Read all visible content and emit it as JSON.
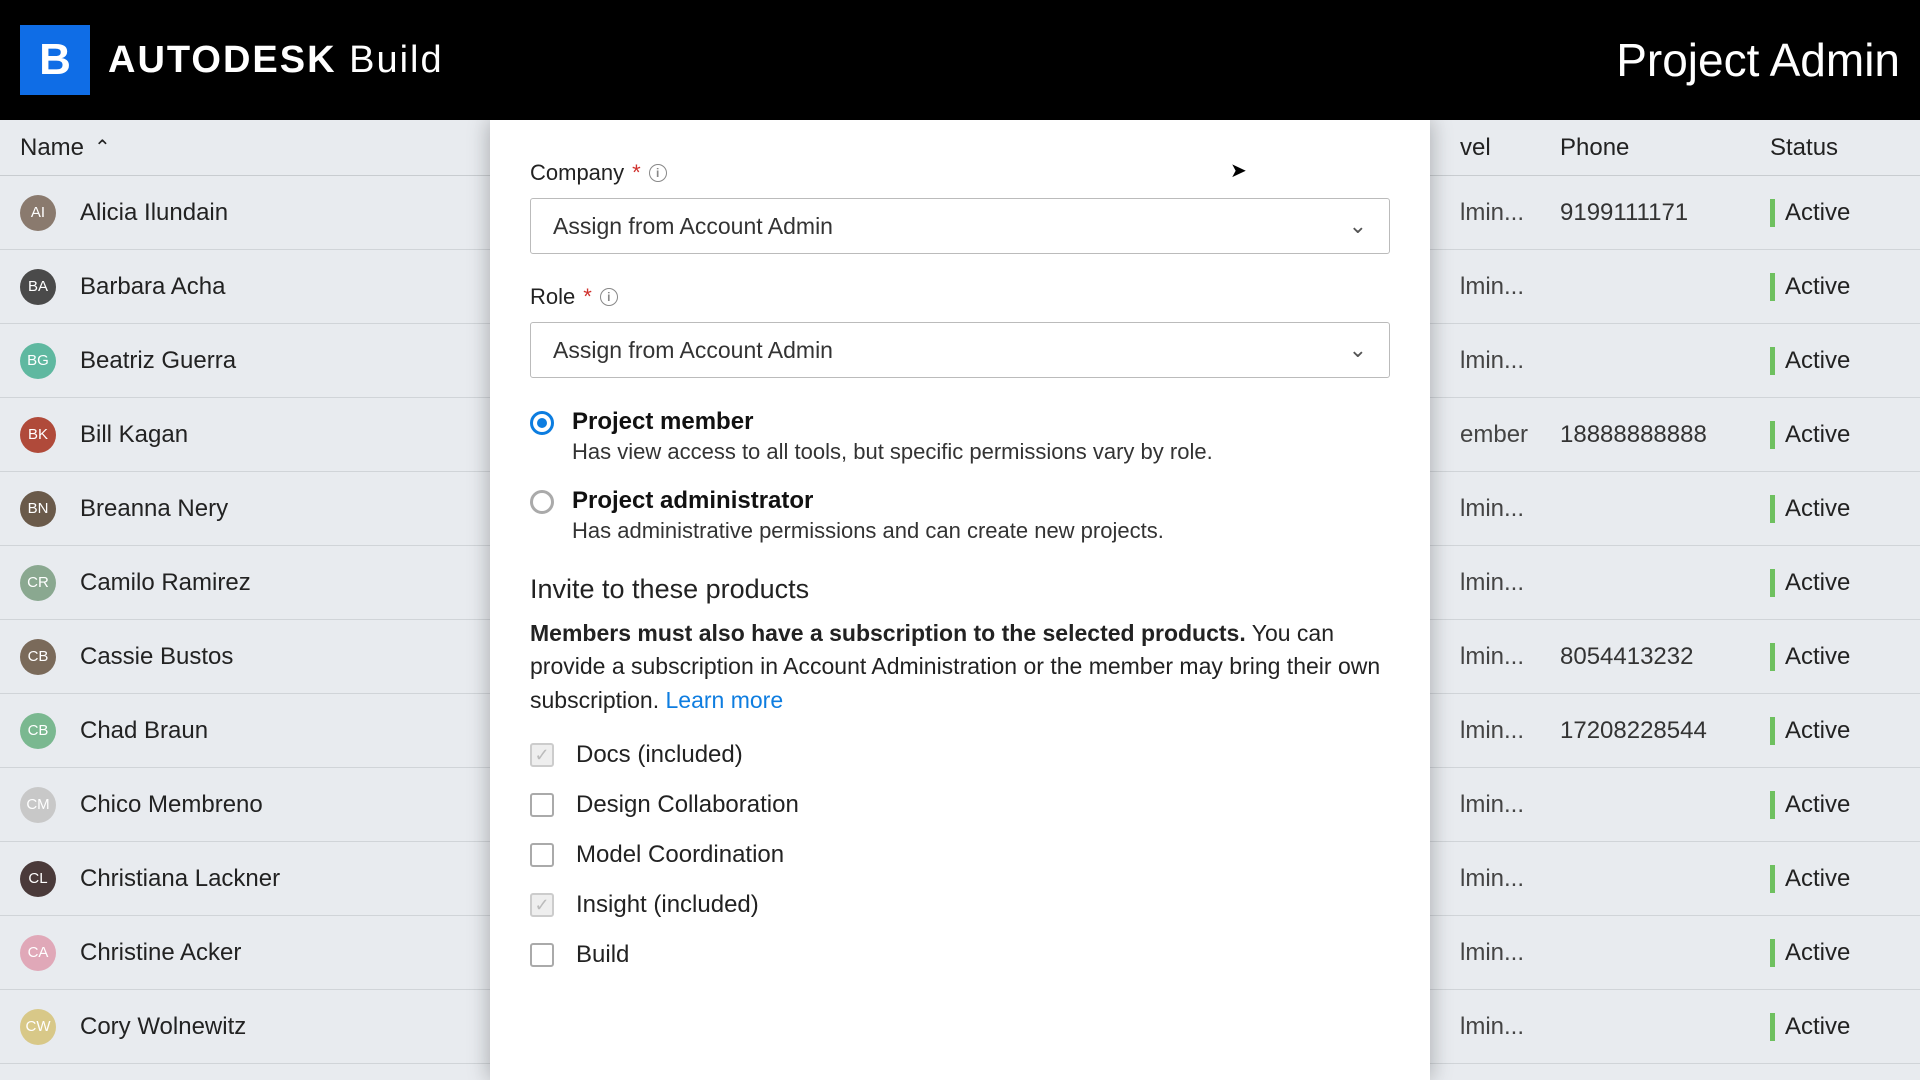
{
  "header": {
    "brand_bold": "AUTODESK",
    "brand_light": "Build",
    "logo_letter": "B",
    "admin": "Project Admin"
  },
  "table": {
    "cols": {
      "name": "Name",
      "level": "vel",
      "phone": "Phone",
      "status": "Status"
    },
    "rows": [
      {
        "name": "Alicia Ilundain",
        "av": "AI",
        "avbg": "#8a7a6e",
        "level": "lmin...",
        "phone": "9199111171",
        "status": "Active"
      },
      {
        "name": "Barbara Acha",
        "av": "BA",
        "avbg": "#4a4a4a",
        "level": "lmin...",
        "phone": "",
        "status": "Active"
      },
      {
        "name": "Beatriz Guerra",
        "av": "BG",
        "avbg": "#5fb8a0",
        "level": "lmin...",
        "phone": "",
        "status": "Active"
      },
      {
        "name": "Bill Kagan",
        "av": "BK",
        "avbg": "#b04a3a",
        "level": "ember",
        "phone": "18888888888",
        "status": "Active"
      },
      {
        "name": "Breanna Nery",
        "av": "BN",
        "avbg": "#6a5a4a",
        "level": "lmin...",
        "phone": "",
        "status": "Active"
      },
      {
        "name": "Camilo Ramirez",
        "av": "CR",
        "avbg": "#8aa890",
        "level": "lmin...",
        "phone": "",
        "status": "Active"
      },
      {
        "name": "Cassie Bustos",
        "av": "CB",
        "avbg": "#7a6a5a",
        "level": "lmin...",
        "phone": "8054413232",
        "status": "Active"
      },
      {
        "name": "Chad Braun",
        "av": "CB",
        "avbg": "#7ab890",
        "level": "lmin...",
        "phone": "17208228544",
        "status": "Active"
      },
      {
        "name": "Chico Membreno",
        "av": "CM",
        "avbg": "#c8c8c8",
        "level": "lmin...",
        "phone": "",
        "status": "Active"
      },
      {
        "name": "Christiana Lackner",
        "av": "CL",
        "avbg": "#4a3a3a",
        "level": "lmin...",
        "phone": "",
        "status": "Active"
      },
      {
        "name": "Christine Acker",
        "av": "CA",
        "avbg": "#e0a8b8",
        "level": "lmin...",
        "phone": "",
        "status": "Active"
      },
      {
        "name": "Cory Wolnewitz",
        "av": "CW",
        "avbg": "#d8c888",
        "level": "lmin...",
        "phone": "",
        "status": "Active"
      }
    ]
  },
  "modal": {
    "company_label": "Company",
    "role_label": "Role",
    "select_placeholder": "Assign from Account Admin",
    "radios": {
      "member": {
        "title": "Project member",
        "desc": "Has view access to all tools, but specific permissions vary by role."
      },
      "admin": {
        "title": "Project administrator",
        "desc": "Has administrative permissions and can create new projects."
      }
    },
    "products": {
      "title": "Invite to these products",
      "desc_bold": "Members must also have a subscription to the selected products.",
      "desc_rest": " You can provide a subscription in Account Administration or the member may bring their own subscription. ",
      "learn": "Learn more",
      "items": [
        {
          "label": "Docs (included)",
          "included": true
        },
        {
          "label": "Design Collaboration",
          "included": false
        },
        {
          "label": "Model Coordination",
          "included": false
        },
        {
          "label": "Insight (included)",
          "included": true
        },
        {
          "label": "Build",
          "included": false
        }
      ]
    }
  }
}
